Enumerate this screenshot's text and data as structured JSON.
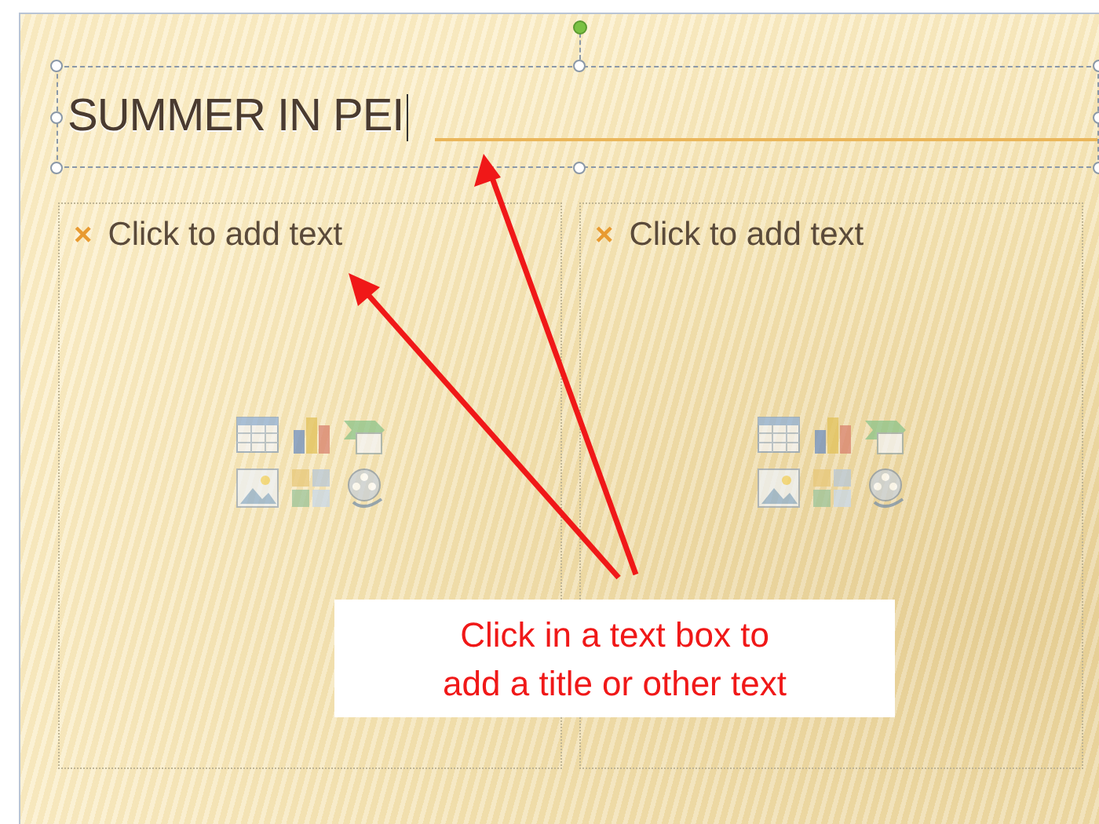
{
  "slide": {
    "title": "SUMMER IN PEI",
    "placeholders": [
      {
        "bullet": "×",
        "prompt": "Click to add text"
      },
      {
        "bullet": "×",
        "prompt": "Click to add text"
      }
    ],
    "callout": "Click in a text box to\nadd a title or other text"
  }
}
